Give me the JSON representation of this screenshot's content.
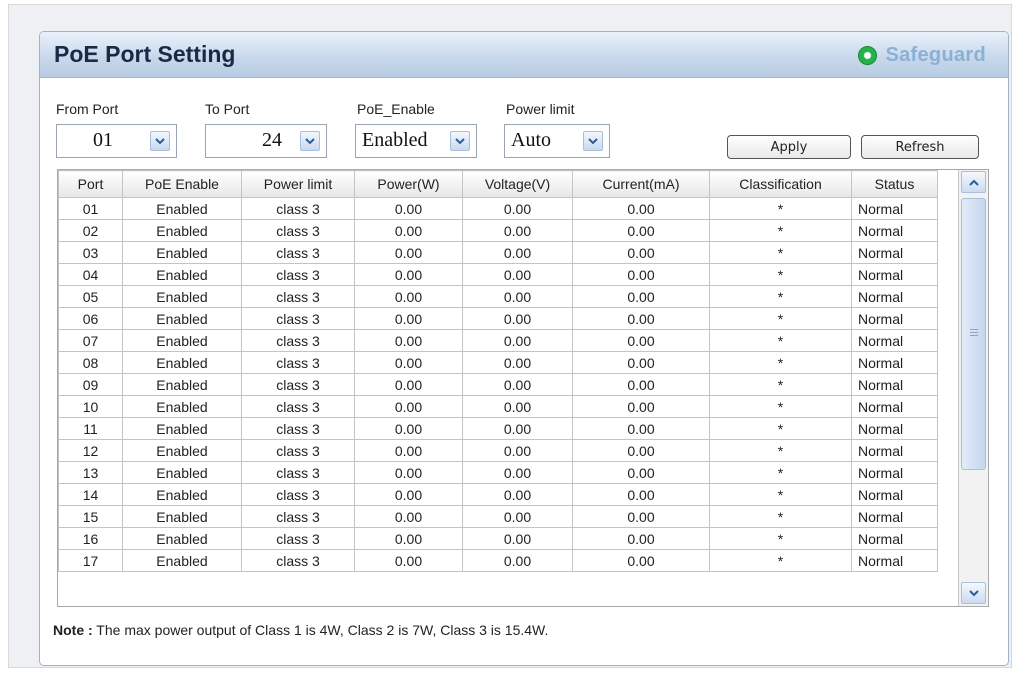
{
  "header": {
    "title": "PoE Port Setting",
    "safeguard_label": "Safeguard",
    "status_color": "#23b24b"
  },
  "controls": {
    "from_port": {
      "label": "From Port",
      "value": "01"
    },
    "to_port": {
      "label": "To Port",
      "value": "24"
    },
    "poe_enable": {
      "label": "PoE_Enable",
      "value": "Enabled"
    },
    "power_limit": {
      "label": "Power limit",
      "value": "Auto"
    },
    "apply_label": "Apply",
    "refresh_label": "Refresh"
  },
  "table": {
    "columns": [
      "Port",
      "PoE Enable",
      "Power limit",
      "Power(W)",
      "Voltage(V)",
      "Current(mA)",
      "Classification",
      "Status"
    ],
    "rows": [
      [
        "01",
        "Enabled",
        "class 3",
        "0.00",
        "0.00",
        "0.00",
        "*",
        "Normal"
      ],
      [
        "02",
        "Enabled",
        "class 3",
        "0.00",
        "0.00",
        "0.00",
        "*",
        "Normal"
      ],
      [
        "03",
        "Enabled",
        "class 3",
        "0.00",
        "0.00",
        "0.00",
        "*",
        "Normal"
      ],
      [
        "04",
        "Enabled",
        "class 3",
        "0.00",
        "0.00",
        "0.00",
        "*",
        "Normal"
      ],
      [
        "05",
        "Enabled",
        "class 3",
        "0.00",
        "0.00",
        "0.00",
        "*",
        "Normal"
      ],
      [
        "06",
        "Enabled",
        "class 3",
        "0.00",
        "0.00",
        "0.00",
        "*",
        "Normal"
      ],
      [
        "07",
        "Enabled",
        "class 3",
        "0.00",
        "0.00",
        "0.00",
        "*",
        "Normal"
      ],
      [
        "08",
        "Enabled",
        "class 3",
        "0.00",
        "0.00",
        "0.00",
        "*",
        "Normal"
      ],
      [
        "09",
        "Enabled",
        "class 3",
        "0.00",
        "0.00",
        "0.00",
        "*",
        "Normal"
      ],
      [
        "10",
        "Enabled",
        "class 3",
        "0.00",
        "0.00",
        "0.00",
        "*",
        "Normal"
      ],
      [
        "11",
        "Enabled",
        "class 3",
        "0.00",
        "0.00",
        "0.00",
        "*",
        "Normal"
      ],
      [
        "12",
        "Enabled",
        "class 3",
        "0.00",
        "0.00",
        "0.00",
        "*",
        "Normal"
      ],
      [
        "13",
        "Enabled",
        "class 3",
        "0.00",
        "0.00",
        "0.00",
        "*",
        "Normal"
      ],
      [
        "14",
        "Enabled",
        "class 3",
        "0.00",
        "0.00",
        "0.00",
        "*",
        "Normal"
      ],
      [
        "15",
        "Enabled",
        "class 3",
        "0.00",
        "0.00",
        "0.00",
        "*",
        "Normal"
      ],
      [
        "16",
        "Enabled",
        "class 3",
        "0.00",
        "0.00",
        "0.00",
        "*",
        "Normal"
      ],
      [
        "17",
        "Enabled",
        "class 3",
        "0.00",
        "0.00",
        "0.00",
        "*",
        "Normal"
      ]
    ]
  },
  "note": {
    "prefix": "Note :",
    "text": " The max power output of Class 1 is 4W, Class 2 is 7W, Class 3 is 15.4W."
  },
  "icons": {
    "dropdown": "chevron-down-icon",
    "scroll_up": "scroll-up-arrow-icon",
    "scroll_down": "scroll-down-arrow-icon",
    "status": "status-dot-icon"
  }
}
